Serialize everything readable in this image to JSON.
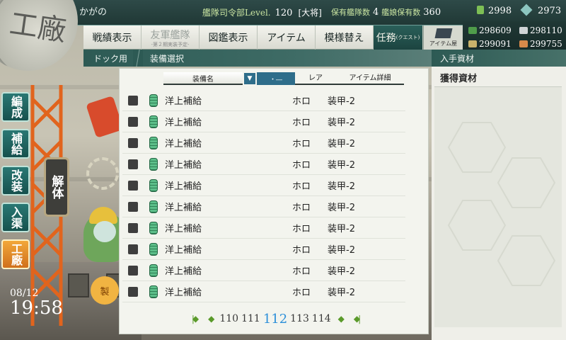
{
  "header": {
    "admiral_name": "かがの",
    "hq_label": "艦隊司令部Level.",
    "hq_level": "120",
    "rank": "[大将]",
    "ship_count_label": "保有艦隊数",
    "fleet_count": "4",
    "ship_holding_label": "艦娘保有数",
    "ship_count": "360",
    "bucket_count": "2998",
    "devmat_count": "2973"
  },
  "menu": {
    "items": [
      {
        "label": "戦績表示"
      },
      {
        "label": "友軍艦隊",
        "sub": "-第２期実装予定-"
      },
      {
        "label": "図鑑表示"
      },
      {
        "label": "アイテム"
      },
      {
        "label": "模様替え"
      },
      {
        "label": "任務",
        "small": "(クエスト)"
      }
    ],
    "item_shop": "アイテム屋"
  },
  "resources": {
    "fuel": "298609",
    "steel": "298110",
    "ammo": "299091",
    "bauxite": "299755"
  },
  "subheader": {
    "crumb": "ドック用",
    "title": "装備選択",
    "obtained": "入手資材"
  },
  "table": {
    "col_name": "装備名",
    "col_sort": "▼",
    "col_sort2": "・―",
    "col_rare": "レア",
    "col_detail": "アイテム詳細",
    "rows": [
      {
        "name": "洋上補給",
        "rare": "ホロ",
        "detail": "装甲-2"
      },
      {
        "name": "洋上補給",
        "rare": "ホロ",
        "detail": "装甲-2"
      },
      {
        "name": "洋上補給",
        "rare": "ホロ",
        "detail": "装甲-2"
      },
      {
        "name": "洋上補給",
        "rare": "ホロ",
        "detail": "装甲-2"
      },
      {
        "name": "洋上補給",
        "rare": "ホロ",
        "detail": "装甲-2"
      },
      {
        "name": "洋上補給",
        "rare": "ホロ",
        "detail": "装甲-2"
      },
      {
        "name": "洋上補給",
        "rare": "ホロ",
        "detail": "装甲-2"
      },
      {
        "name": "洋上補給",
        "rare": "ホロ",
        "detail": "装甲-2"
      },
      {
        "name": "洋上補給",
        "rare": "ホロ",
        "detail": "装甲-2"
      },
      {
        "name": "洋上補給",
        "rare": "ホロ",
        "detail": "装甲-2"
      }
    ]
  },
  "pager": {
    "first": "|◆",
    "prev": "◆",
    "pages": [
      "110",
      "111",
      "112",
      "113",
      "114"
    ],
    "current": "112",
    "next": "◆",
    "last": "◆|"
  },
  "obtained_panel": {
    "label": "獲得資材"
  },
  "side": {
    "emblem": "工廠",
    "nav": [
      "編成",
      "補給",
      "改装",
      "入渠",
      "工廠"
    ],
    "dismantle": "解体",
    "dock_btn": "製"
  },
  "clock": {
    "date": "08/12",
    "time": "19:58"
  },
  "colors": {
    "header_bg": "#203835",
    "accent_teal": "#2d5a54",
    "current_page": "#2b8fd9",
    "drum_green": "#5dbf8a"
  }
}
